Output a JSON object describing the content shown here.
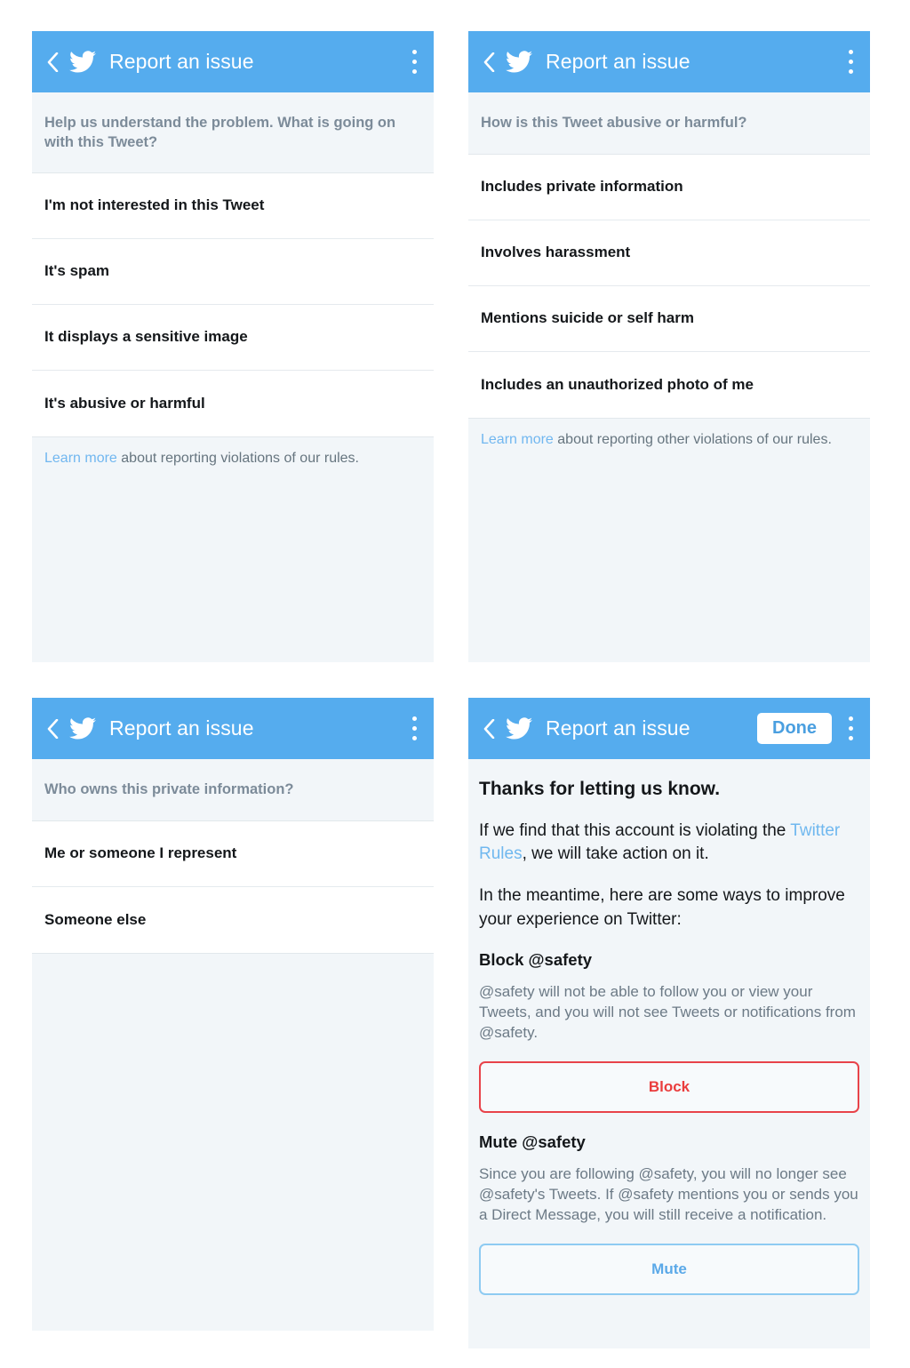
{
  "colors": {
    "twitter_blue": "#55acee",
    "panel_bg": "#f2f6f9",
    "link_blue": "#71b7f0",
    "danger_red": "#ea3d3d",
    "prompt_gray": "#7c8b99"
  },
  "common": {
    "app_title": "Report an issue",
    "back_icon": "back-chevron-icon",
    "logo_icon": "twitter-bird-icon",
    "overflow_icon": "kebab-menu-icon"
  },
  "panel1": {
    "title": "Report an issue",
    "prompt": "Help us understand the problem. What is going on with this Tweet?",
    "options": [
      "I'm not interested in this Tweet",
      "It's spam",
      "It displays a sensitive image",
      "It's abusive or harmful"
    ],
    "footer_link": "Learn more",
    "footer_rest": " about reporting violations of our rules."
  },
  "panel2": {
    "title": "Report an issue",
    "prompt": "How is this Tweet abusive or harmful?",
    "options": [
      "Includes private information",
      "Involves harassment",
      "Mentions suicide or self harm",
      "Includes an unauthorized photo of me"
    ],
    "footer_link": "Learn more",
    "footer_rest": " about reporting other violations of our rules."
  },
  "panel3": {
    "title": "Report an issue",
    "prompt": "Who owns this private information?",
    "options": [
      "Me or someone I represent",
      "Someone else"
    ]
  },
  "panel4": {
    "title": "Report an issue",
    "done_label": "Done",
    "thanks_title": "Thanks for letting us know.",
    "para1_before": "If we find that this account is violating the ",
    "para1_link": "Twitter Rules",
    "para1_after": ", we will take action on it.",
    "para2": "In the meantime, here are some ways to improve your experience on Twitter:",
    "block_head": "Block @safety",
    "block_desc": "@safety will not be able to follow you or view your Tweets, and you will not see Tweets or notifications from @safety.",
    "block_button": "Block",
    "mute_head": "Mute @safety",
    "mute_desc": "Since you are following @safety, you will no longer see @safety's Tweets. If @safety mentions you or sends you a Direct Message, you will still receive a notification.",
    "mute_button": "Mute"
  }
}
